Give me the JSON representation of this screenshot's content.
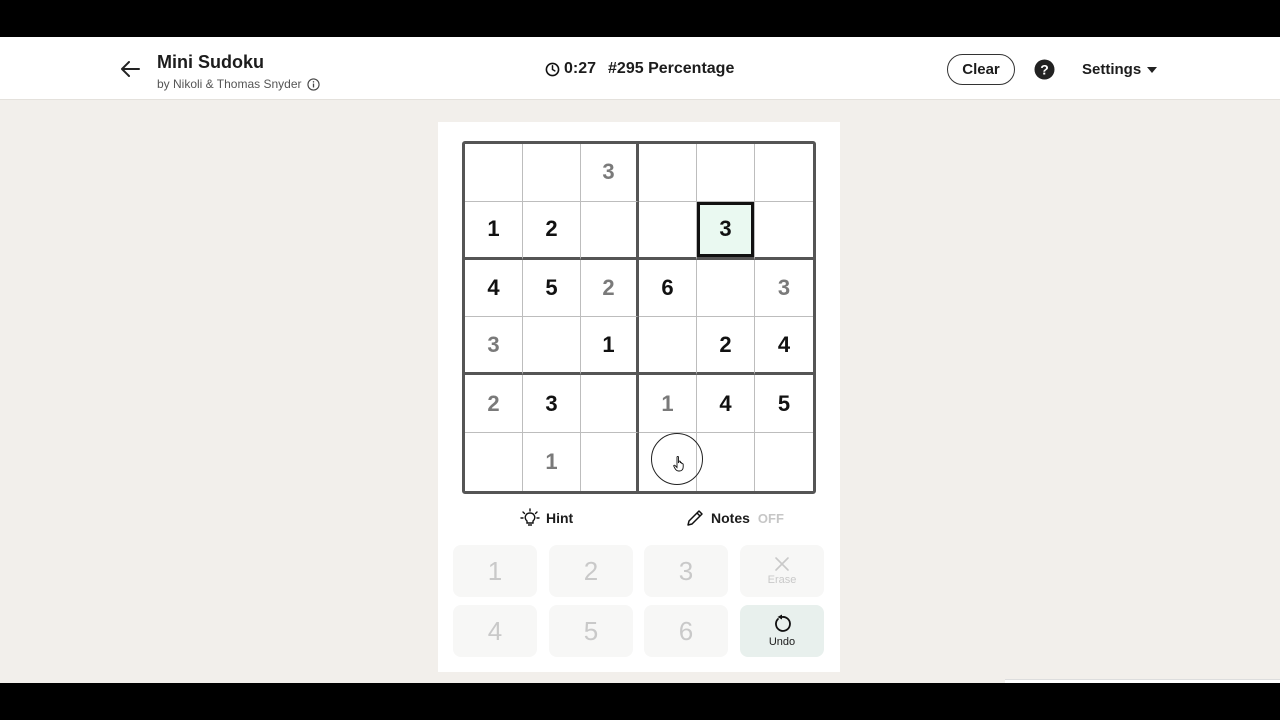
{
  "header": {
    "title": "Mini Sudoku",
    "byline": "by Nikoli & Thomas Snyder",
    "timer": "0:27",
    "puzzle_label": "#295 Percentage",
    "clear_label": "Clear",
    "settings_label": "Settings"
  },
  "grid": {
    "rows": [
      [
        {
          "v": ""
        },
        {
          "v": ""
        },
        {
          "v": "3",
          "t": "user"
        },
        {
          "v": ""
        },
        {
          "v": ""
        },
        {
          "v": ""
        }
      ],
      [
        {
          "v": "1",
          "t": "given"
        },
        {
          "v": "2",
          "t": "given"
        },
        {
          "v": ""
        },
        {
          "v": ""
        },
        {
          "v": "3",
          "t": "given",
          "selected": true
        },
        {
          "v": ""
        }
      ],
      [
        {
          "v": "4",
          "t": "given"
        },
        {
          "v": "5",
          "t": "given"
        },
        {
          "v": "2",
          "t": "user"
        },
        {
          "v": "6",
          "t": "given"
        },
        {
          "v": ""
        },
        {
          "v": "3",
          "t": "user"
        }
      ],
      [
        {
          "v": "3",
          "t": "user"
        },
        {
          "v": ""
        },
        {
          "v": "1",
          "t": "given"
        },
        {
          "v": ""
        },
        {
          "v": "2",
          "t": "given"
        },
        {
          "v": "4",
          "t": "given"
        }
      ],
      [
        {
          "v": "2",
          "t": "user"
        },
        {
          "v": "3",
          "t": "given"
        },
        {
          "v": ""
        },
        {
          "v": "1",
          "t": "user"
        },
        {
          "v": "4",
          "t": "given"
        },
        {
          "v": "5",
          "t": "given"
        }
      ],
      [
        {
          "v": ""
        },
        {
          "v": "1",
          "t": "user"
        },
        {
          "v": ""
        },
        {
          "v": ""
        },
        {
          "v": ""
        },
        {
          "v": ""
        }
      ]
    ]
  },
  "tools": {
    "hint_label": "Hint",
    "notes_label": "Notes",
    "notes_state": "OFF"
  },
  "keypad": {
    "digits": [
      "1",
      "2",
      "3",
      "4",
      "5",
      "6"
    ],
    "erase_label": "Erase",
    "undo_label": "Undo"
  },
  "colors": {
    "selected_fill": "#dcf5e8",
    "user_digit": "#7a7a7a",
    "given_digit": "#111111",
    "background": "#f2efeb"
  }
}
